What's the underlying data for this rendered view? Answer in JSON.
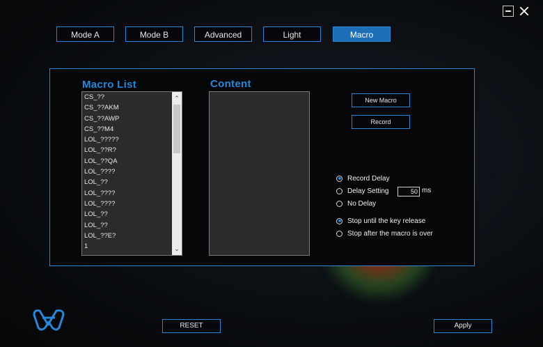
{
  "window": {
    "minimize_icon": "minimize-icon",
    "close_icon": "close-icon"
  },
  "tabs": [
    {
      "label": "Mode A",
      "active": false
    },
    {
      "label": "Mode B",
      "active": false
    },
    {
      "label": "Advanced",
      "active": false
    },
    {
      "label": "Light",
      "active": false
    },
    {
      "label": "Macro",
      "active": true
    }
  ],
  "macro_list": {
    "title": "Macro List",
    "items": [
      "CS_??",
      "CS_??AKM",
      "CS_??AWP",
      "CS_??M4",
      "LOL_?????",
      "LOL_??R?",
      "LOL_??QA",
      "LOL_????",
      "LOL_??",
      "LOL_????",
      "LOL_????",
      "LOL_??",
      "LOL_??",
      "LOL_??E?",
      "1"
    ]
  },
  "content": {
    "title": "Content"
  },
  "buttons": {
    "new_macro": "New Macro",
    "record": "Record",
    "reset": "RESET",
    "apply": "Apply"
  },
  "options": {
    "record_delay": "Record Delay",
    "delay_setting": "Delay Setting",
    "delay_value": "50",
    "delay_unit": "ms",
    "no_delay": "No Delay",
    "stop_key_release": "Stop until the key release",
    "stop_macro_over": "Stop after the macro is over",
    "selected_delay": "record_delay",
    "selected_stop": "stop_key_release"
  },
  "colors": {
    "accent": "#2b86d6",
    "active_tab": "#1c6fb6"
  }
}
